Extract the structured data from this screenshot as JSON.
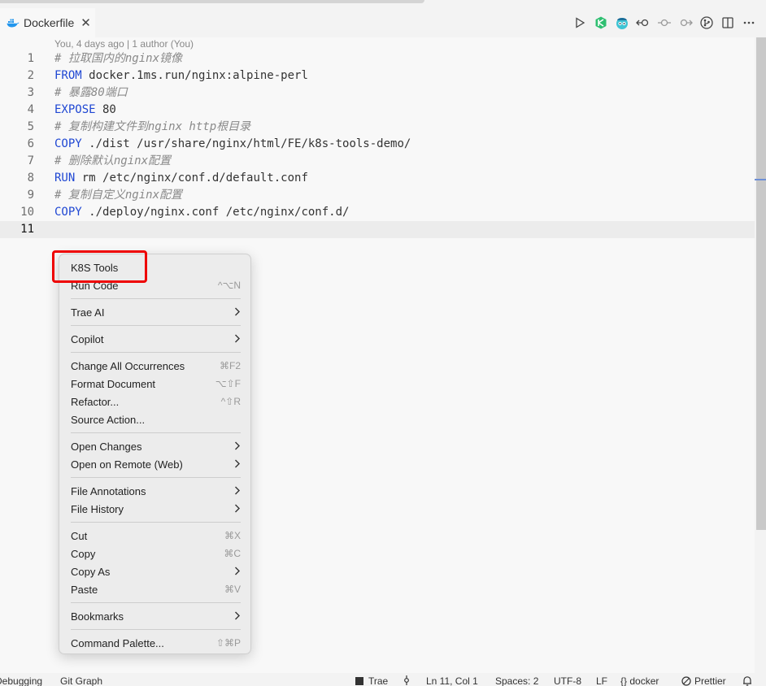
{
  "tab": {
    "label": "Dockerfile",
    "close": "✕"
  },
  "toolbar": {
    "icons": [
      "run-icon",
      "k8s-icon",
      "copilot-icon",
      "go-back-icon",
      "timeline-dot-icon",
      "go-forward-icon",
      "source-control-icon",
      "split-editor-icon",
      "more-actions-icon"
    ]
  },
  "blame": "You, 4 days ago | 1 author (You)",
  "lines": [
    {
      "n": "1",
      "parts": [
        {
          "t": "# 拉取国内的nginx镜像",
          "c": "cm"
        }
      ]
    },
    {
      "n": "2",
      "parts": [
        {
          "t": "FROM",
          "c": "kw"
        },
        {
          "t": " docker.1ms.run/nginx:alpine-perl",
          "c": "tx"
        }
      ]
    },
    {
      "n": "3",
      "parts": [
        {
          "t": "# 暴露80端口",
          "c": "cm"
        }
      ]
    },
    {
      "n": "4",
      "parts": [
        {
          "t": "EXPOSE",
          "c": "kw"
        },
        {
          "t": " 80",
          "c": "tx"
        }
      ]
    },
    {
      "n": "5",
      "parts": [
        {
          "t": "# 复制构建文件到nginx http根目录",
          "c": "cm"
        }
      ]
    },
    {
      "n": "6",
      "parts": [
        {
          "t": "COPY",
          "c": "kw"
        },
        {
          "t": " ./dist /usr/share/nginx/html/FE/k8s-tools-demo/",
          "c": "tx"
        }
      ]
    },
    {
      "n": "7",
      "parts": [
        {
          "t": "# 删除默认nginx配置",
          "c": "cm"
        }
      ]
    },
    {
      "n": "8",
      "parts": [
        {
          "t": "RUN",
          "c": "kw"
        },
        {
          "t": " rm /etc/nginx/conf.d/default.conf",
          "c": "tx"
        }
      ]
    },
    {
      "n": "9",
      "parts": [
        {
          "t": "# 复制自定义nginx配置",
          "c": "cm"
        }
      ]
    },
    {
      "n": "10",
      "parts": [
        {
          "t": "COPY",
          "c": "kw"
        },
        {
          "t": " ./deploy/nginx.conf /etc/nginx/conf.d/",
          "c": "tx"
        }
      ]
    },
    {
      "n": "11",
      "parts": []
    }
  ],
  "current_line": "11",
  "context_menu": {
    "items": [
      {
        "label": "K8S Tools",
        "shortcut": "",
        "submenu": false
      },
      {
        "label": "Run Code",
        "shortcut": "^⌥N",
        "submenu": false
      },
      {
        "sep": true
      },
      {
        "label": "Trae AI",
        "shortcut": "",
        "submenu": true
      },
      {
        "sep": true
      },
      {
        "label": "Copilot",
        "shortcut": "",
        "submenu": true
      },
      {
        "sep": true
      },
      {
        "label": "Change All Occurrences",
        "shortcut": "⌘F2",
        "submenu": false
      },
      {
        "label": "Format Document",
        "shortcut": "⌥⇧F",
        "submenu": false
      },
      {
        "label": "Refactor...",
        "shortcut": "^⇧R",
        "submenu": false
      },
      {
        "label": "Source Action...",
        "shortcut": "",
        "submenu": false
      },
      {
        "sep": true
      },
      {
        "label": "Open Changes",
        "shortcut": "",
        "submenu": true
      },
      {
        "label": "Open on Remote (Web)",
        "shortcut": "",
        "submenu": true
      },
      {
        "sep": true
      },
      {
        "label": "File Annotations",
        "shortcut": "",
        "submenu": true
      },
      {
        "label": "File History",
        "shortcut": "",
        "submenu": true
      },
      {
        "sep": true
      },
      {
        "label": "Cut",
        "shortcut": "⌘X",
        "submenu": false
      },
      {
        "label": "Copy",
        "shortcut": "⌘C",
        "submenu": false
      },
      {
        "label": "Copy As",
        "shortcut": "",
        "submenu": true
      },
      {
        "label": "Paste",
        "shortcut": "⌘V",
        "submenu": false
      },
      {
        "sep": true
      },
      {
        "label": "Bookmarks",
        "shortcut": "",
        "submenu": true
      },
      {
        "sep": true
      },
      {
        "label": "Command Palette...",
        "shortcut": "⇧⌘P",
        "submenu": false
      }
    ]
  },
  "statusbar": {
    "debugging": "Debugging",
    "git_graph": "Git Graph",
    "trae": "Trae",
    "position": "Ln 11, Col 1",
    "spaces": "Spaces: 2",
    "encoding": "UTF-8",
    "eol": "LF",
    "language": "{} docker",
    "prettier": "Prettier"
  }
}
